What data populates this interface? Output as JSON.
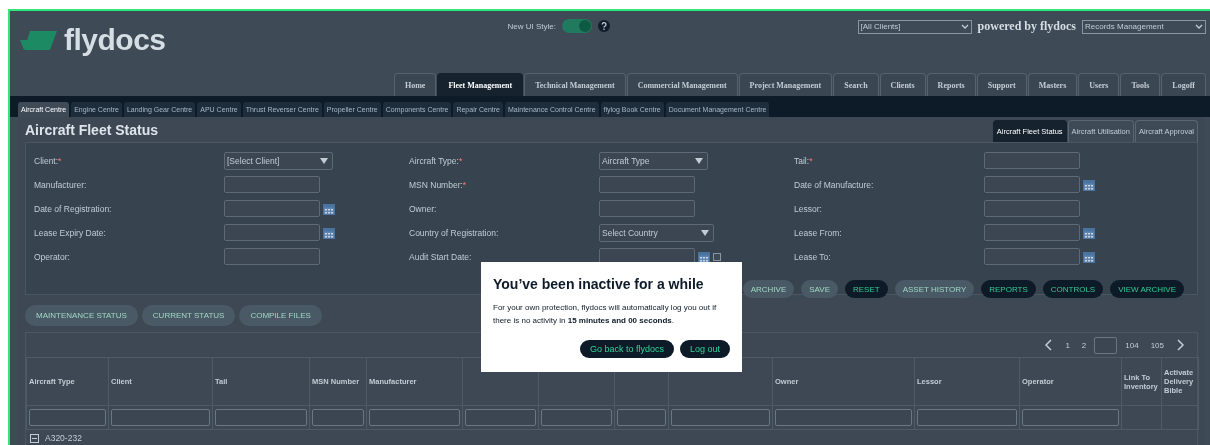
{
  "header": {
    "logo": "flydocs",
    "ui_style_label": "New UI Style:",
    "ui_style_on": true,
    "client_select": "[All Clients]",
    "powered_by": "powered by flydocs",
    "module_select": "Records Management"
  },
  "main_tabs": [
    {
      "label": "Home",
      "selected": false
    },
    {
      "label": "Fleet Management",
      "selected": true
    },
    {
      "label": "Technical Management",
      "selected": false
    },
    {
      "label": "Commercial Management",
      "selected": false
    },
    {
      "label": "Project Management",
      "selected": false
    },
    {
      "label": "Search",
      "selected": false
    },
    {
      "label": "Clients",
      "selected": false
    },
    {
      "label": "Reports",
      "selected": false
    },
    {
      "label": "Support",
      "selected": false
    },
    {
      "label": "Masters",
      "selected": false
    },
    {
      "label": "Users",
      "selected": false
    },
    {
      "label": "Tools",
      "selected": false
    },
    {
      "label": "Logoff",
      "selected": false
    }
  ],
  "centre_tabs": [
    {
      "label": "Aircraft Centre",
      "selected": true
    },
    {
      "label": "Engine Centre",
      "selected": false
    },
    {
      "label": "Landing Gear Centre",
      "selected": false
    },
    {
      "label": "APU Centre",
      "selected": false
    },
    {
      "label": "Thrust Reverser Centre",
      "selected": false
    },
    {
      "label": "Propeller Centre",
      "selected": false
    },
    {
      "label": "Components Centre",
      "selected": false
    },
    {
      "label": "Repair Centre",
      "selected": false
    },
    {
      "label": "Maintenance Control Centre",
      "selected": false
    },
    {
      "label": "flylog Book Centre",
      "selected": false
    },
    {
      "label": "Document Management Centre",
      "selected": false
    }
  ],
  "page_title": "Aircraft Fleet Status",
  "view_tabs": [
    {
      "label": "Aircraft Fleet Status",
      "selected": true
    },
    {
      "label": "Aircraft Utilisation",
      "selected": false
    },
    {
      "label": "Aircraft Approval",
      "selected": false
    }
  ],
  "form": {
    "columns": [
      [
        {
          "label": "Client:",
          "mark": "*",
          "kind": "select",
          "value": "[Select Client]"
        },
        {
          "label": "Manufacturer:",
          "kind": "text"
        },
        {
          "label": "Date of Registration:",
          "kind": "date"
        },
        {
          "label": "Lease Expiry Date:",
          "kind": "date"
        },
        {
          "label": "Operator:",
          "kind": "text"
        }
      ],
      [
        {
          "label": "Aircraft Type:",
          "mark": "*",
          "kind": "select",
          "value": "Aircraft Type"
        },
        {
          "label": "MSN Number:",
          "mark": "*",
          "kind": "text"
        },
        {
          "label": "Owner:",
          "kind": "text"
        },
        {
          "label": "Country of Registration:",
          "kind": "select",
          "value": "Select Country"
        },
        {
          "label": "Audit Start Date:",
          "kind": "datecheck",
          "checked": false
        }
      ],
      [
        {
          "label": "Tail:",
          "mark": "*",
          "kind": "text"
        },
        {
          "label": "Date of Manufacture:",
          "kind": "date"
        },
        {
          "label": "Lessor:",
          "kind": "text"
        },
        {
          "label": "Lease From:",
          "kind": "date"
        },
        {
          "label": "Lease To:",
          "kind": "date"
        }
      ]
    ]
  },
  "actions": [
    {
      "label": "ARCHIVE",
      "disabled": true
    },
    {
      "label": "SAVE",
      "disabled": true
    },
    {
      "label": "RESET",
      "disabled": false
    },
    {
      "label": "ASSET HISTORY",
      "disabled": true
    },
    {
      "label": "REPORTS",
      "disabled": false
    },
    {
      "label": "CONTROLS",
      "disabled": false
    },
    {
      "label": "VIEW ARCHIVE",
      "disabled": false
    }
  ],
  "status_buttons": [
    {
      "label": "MAINTENANCE STATUS",
      "disabled": true
    },
    {
      "label": "CURRENT STATUS",
      "disabled": true
    },
    {
      "label": "COMPILE FILES",
      "disabled": true
    }
  ],
  "pager": {
    "pages_before": [
      "1",
      "2"
    ],
    "pages_after": [
      "104",
      "105"
    ]
  },
  "table": {
    "columns": [
      {
        "label": "Aircraft Type",
        "filter": true
      },
      {
        "label": "Client",
        "filter": true
      },
      {
        "label": "Tail",
        "filter": true
      },
      {
        "label": "MSN Number",
        "filter": true
      },
      {
        "label": "Manufacturer",
        "filter": true
      },
      {
        "filter": true
      },
      {
        "filter": true
      },
      {
        "filter": true
      },
      {
        "filter": true
      },
      {
        "label": "Owner",
        "filter": true
      },
      {
        "label": "Lessor",
        "filter": true
      },
      {
        "label": "Operator",
        "filter": true
      },
      {
        "label": "Link To Inventory",
        "filter": false
      },
      {
        "label": "Activate Delivery Bible",
        "filter": false
      }
    ],
    "groups": [
      {
        "label": "A320-232",
        "expanded": true
      }
    ]
  },
  "dialog": {
    "title": "You’ve been inactive for a while",
    "message": "For your own protection, flydocs will automatically log you out if there is no activity in **15 minutes and 00 seconds**.",
    "buttons": [
      "Go back to flydocs",
      "Log out"
    ]
  }
}
